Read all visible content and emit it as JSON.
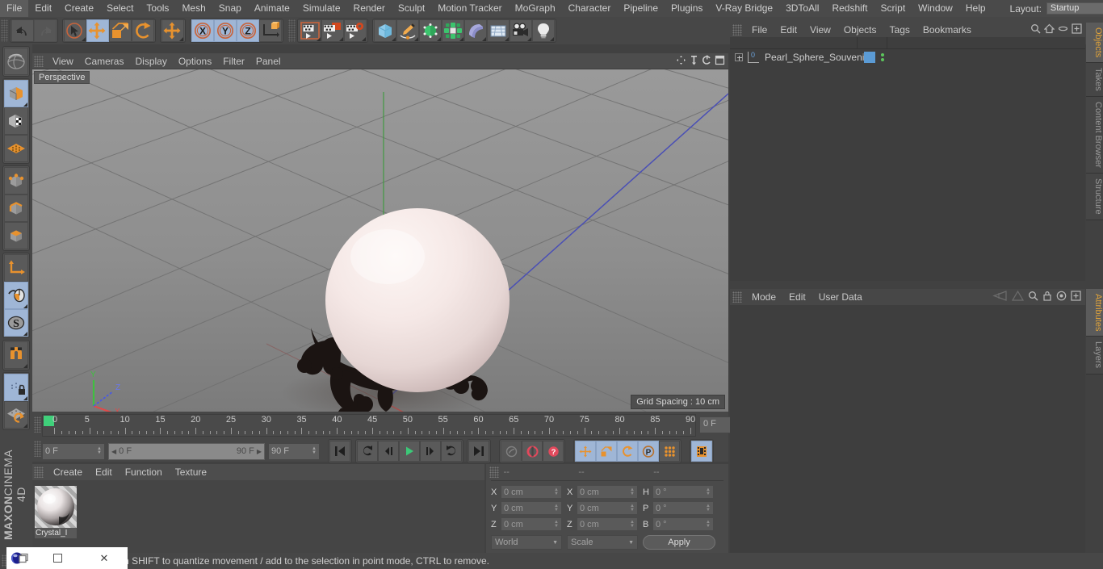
{
  "menubar": {
    "items": [
      "File",
      "Edit",
      "Create",
      "Select",
      "Tools",
      "Mesh",
      "Snap",
      "Animate",
      "Simulate",
      "Render",
      "Sculpt",
      "Motion Tracker",
      "MoGraph",
      "Character",
      "Pipeline",
      "Plugins",
      "V-Ray Bridge",
      "3DToAll",
      "Redshift",
      "Script",
      "Window",
      "Help"
    ],
    "layout_label": "Layout:",
    "layout_value": "Startup",
    "icons": [
      "search-icon",
      "home-icon",
      "minimize-icon",
      "maximize-icon"
    ]
  },
  "toolbar": {
    "groups": [
      {
        "name": "undo-redo",
        "buttons": [
          {
            "icon": "undo-icon",
            "label": "Undo",
            "selected": false,
            "dim": false,
            "corner": false
          },
          {
            "icon": "redo-icon",
            "label": "Redo",
            "selected": false,
            "dim": true,
            "corner": false
          }
        ]
      },
      {
        "name": "selection-transform",
        "buttons": [
          {
            "icon": "live-selection-icon",
            "label": "Live Selection",
            "selected": false,
            "dim": false,
            "corner": true
          },
          {
            "icon": "move-icon",
            "label": "Move",
            "selected": true,
            "dim": false,
            "corner": false
          },
          {
            "icon": "scale-icon",
            "label": "Scale",
            "selected": false,
            "dim": false,
            "corner": false
          },
          {
            "icon": "rotate-icon",
            "label": "Rotate",
            "selected": false,
            "dim": false,
            "corner": false
          }
        ]
      },
      {
        "name": "move-dup",
        "buttons": [
          {
            "icon": "move-icon",
            "label": "Move",
            "selected": false,
            "dim": false,
            "corner": true
          }
        ]
      },
      {
        "name": "axis-locks",
        "buttons": [
          {
            "icon": "x-axis-icon",
            "label": "X Axis",
            "selected": true,
            "dim": false,
            "corner": false
          },
          {
            "icon": "y-axis-icon",
            "label": "Y Axis",
            "selected": true,
            "dim": false,
            "corner": false
          },
          {
            "icon": "z-axis-icon",
            "label": "Z Axis",
            "selected": true,
            "dim": false,
            "corner": false
          },
          {
            "icon": "world-coordinates-icon",
            "label": "World/Object Coordinates",
            "selected": false,
            "dim": false,
            "corner": false
          }
        ]
      },
      {
        "name": "render",
        "buttons": [
          {
            "icon": "render-view-icon",
            "label": "Render View",
            "selected": false,
            "dim": false,
            "corner": true
          },
          {
            "icon": "render-to-picture-viewer-icon",
            "label": "Render to Picture Viewer",
            "selected": false,
            "dim": false,
            "corner": true
          },
          {
            "icon": "render-settings-icon",
            "label": "Edit Render Settings",
            "selected": false,
            "dim": false,
            "corner": true
          }
        ]
      },
      {
        "name": "create-objects",
        "buttons": [
          {
            "icon": "cube-primitive-icon",
            "label": "Add Cube Object",
            "selected": false,
            "dim": false,
            "corner": true
          },
          {
            "icon": "spline-pen-icon",
            "label": "Add Spline Object",
            "selected": false,
            "dim": false,
            "corner": true
          },
          {
            "icon": "generator-icon",
            "label": "Add Generator Object",
            "selected": false,
            "dim": false,
            "corner": true
          },
          {
            "icon": "cloner-icon",
            "label": "Add MoGraph Object",
            "selected": false,
            "dim": false,
            "corner": true
          },
          {
            "icon": "deformer-icon",
            "label": "Add Deformer Object",
            "selected": false,
            "dim": false,
            "corner": true
          },
          {
            "icon": "environment-icon",
            "label": "Add Environment Object",
            "selected": false,
            "dim": false,
            "corner": true
          },
          {
            "icon": "camera-icon",
            "label": "Add Camera Object",
            "selected": false,
            "dim": false,
            "corner": true
          },
          {
            "icon": "light-icon",
            "label": "Add Light Object",
            "selected": false,
            "dim": false,
            "corner": true
          }
        ]
      }
    ]
  },
  "left_toolbar": {
    "groups": [
      {
        "buttons": [
          {
            "icon": "undo-view-icon",
            "label": "Undo View",
            "selected": false,
            "corner": false
          }
        ]
      },
      {
        "buttons": [
          {
            "icon": "model-mode-icon",
            "label": "Model Mode",
            "selected": true,
            "corner": true
          },
          {
            "icon": "texture-mode-icon",
            "label": "Texture Mode",
            "selected": false,
            "corner": false
          },
          {
            "icon": "workplane-mode-icon",
            "label": "Workplane Mode",
            "selected": false,
            "corner": false
          }
        ]
      },
      {
        "buttons": [
          {
            "icon": "points-mode-icon",
            "label": "Points Mode",
            "selected": false,
            "corner": false
          },
          {
            "icon": "edges-mode-icon",
            "label": "Edges Mode",
            "selected": false,
            "corner": false
          },
          {
            "icon": "polygons-mode-icon",
            "label": "Polygons Mode",
            "selected": false,
            "corner": false
          }
        ]
      },
      {
        "buttons": [
          {
            "icon": "axis-modify-icon",
            "label": "Enable Axis Modification",
            "selected": false,
            "corner": false
          },
          {
            "icon": "viewport-solo-icon",
            "label": "Enable Viewport Solo",
            "selected": true,
            "corner": true
          },
          {
            "icon": "soft-selection-icon",
            "label": "Soft Selection",
            "selected": true,
            "corner": true
          }
        ]
      },
      {
        "buttons": [
          {
            "icon": "magnet-icon",
            "label": "Magnet",
            "selected": false,
            "corner": true
          }
        ]
      },
      {
        "buttons": [
          {
            "icon": "lock-workplane-icon",
            "label": "Lock Workplane",
            "selected": true,
            "corner": true
          },
          {
            "icon": "planar-workplane-icon",
            "label": "Planar Workplane",
            "selected": false,
            "corner": true
          }
        ]
      }
    ],
    "brand_line1": "MAXON",
    "brand_line2": "CINEMA 4D"
  },
  "viewport": {
    "menu": [
      "View",
      "Cameras",
      "Display",
      "Options",
      "Filter",
      "Panel"
    ],
    "header_icons": [
      "move-view-icon",
      "scale-view-icon",
      "rotate-view-icon",
      "maximize-view-icon"
    ],
    "label": "Perspective",
    "grid_spacing": "Grid Spacing : 10 cm",
    "axis_labels": {
      "x": "X",
      "y": "Y",
      "z": "Z"
    },
    "scene": {
      "object_name": "Pearl_Sphere_Souvenir",
      "sphere_color": "#f3e6e4",
      "stand_color": "#1a1210",
      "floor_color": "#8c8c8c",
      "grid_line_color": "#6e6e6e"
    }
  },
  "timeline": {
    "ruler_labels": [
      "0",
      "5",
      "10",
      "15",
      "20",
      "25",
      "30",
      "35",
      "40",
      "45",
      "50",
      "55",
      "60",
      "65",
      "70",
      "75",
      "80",
      "85",
      "90"
    ],
    "current_frame_box": "0 F",
    "start_field": "0 F",
    "range_left": "0 F",
    "range_right": "90 F",
    "end_field": "90 F",
    "playback_buttons": [
      {
        "icon": "go-to-start-icon",
        "label": "Go To Start",
        "selected": false
      },
      {
        "icon": "previous-keyframe-icon",
        "label": "Go To Previous Key",
        "selected": false
      },
      {
        "icon": "step-back-icon",
        "label": "Go To Previous Frame",
        "selected": false
      },
      {
        "icon": "play-forward-icon",
        "label": "Play Forwards",
        "selected": false
      },
      {
        "icon": "step-forward-icon",
        "label": "Go To Next Frame",
        "selected": false
      },
      {
        "icon": "next-keyframe-icon",
        "label": "Go To Next Key",
        "selected": false
      },
      {
        "icon": "go-to-end-icon",
        "label": "Go To End",
        "selected": false
      }
    ],
    "record_buttons": [
      {
        "icon": "autokeying-icon",
        "label": "Autokeying",
        "selected": false,
        "dim": true
      },
      {
        "icon": "record-active-objects-icon",
        "label": "Record Active Objects",
        "selected": false
      },
      {
        "icon": "keyframe-selection-icon",
        "label": "Keyframe Selection",
        "selected": false
      }
    ],
    "param_buttons": [
      {
        "icon": "position-key-icon",
        "label": "Position",
        "selected": true
      },
      {
        "icon": "scale-key-icon",
        "label": "Scale",
        "selected": true
      },
      {
        "icon": "rotation-key-icon",
        "label": "Rotation",
        "selected": true
      },
      {
        "icon": "pla-key-icon",
        "label": "Point Level Animation",
        "selected": true
      },
      {
        "icon": "parameter-key-icon",
        "label": "Parameter",
        "selected": false
      }
    ],
    "dope_sheet_button": {
      "icon": "dope-sheet-icon",
      "label": "Timeline",
      "selected": true
    }
  },
  "material_manager": {
    "menu": [
      "Create",
      "Edit",
      "Function",
      "Texture"
    ],
    "materials": [
      {
        "name": "Crystal_I",
        "selected": true
      }
    ]
  },
  "coordinates": {
    "column_headers": [
      "--",
      "--",
      "--"
    ],
    "rows": [
      {
        "pos_label": "X",
        "pos_value": "0 cm",
        "size_label": "X",
        "size_value": "0 cm",
        "rot_label": "H",
        "rot_value": "0 °"
      },
      {
        "pos_label": "Y",
        "pos_value": "0 cm",
        "size_label": "Y",
        "size_value": "0 cm",
        "rot_label": "P",
        "rot_value": "0 °"
      },
      {
        "pos_label": "Z",
        "pos_value": "0 cm",
        "size_label": "Z",
        "size_value": "0 cm",
        "rot_label": "B",
        "rot_value": "0 °"
      }
    ],
    "system_value": "World",
    "mode_value": "Scale",
    "apply_label": "Apply"
  },
  "object_manager": {
    "menu": [
      "File",
      "Edit",
      "View",
      "Objects",
      "Tags",
      "Bookmarks"
    ],
    "icons": [
      "search-icon",
      "home-icon",
      "ellipse-icon",
      "plus-box-icon"
    ],
    "objects": [
      {
        "name": "Pearl_Sphere_Souvenir",
        "layer_number": "0",
        "swatch_color": "#5b9bd5",
        "selected": false
      }
    ]
  },
  "attribute_manager": {
    "menu": [
      "Mode",
      "Edit",
      "User Data"
    ],
    "icons": [
      "mode-left-icon",
      "mode-right-icon",
      "search-icon",
      "lock-icon",
      "target-icon",
      "plus-box-icon"
    ],
    "content": ""
  },
  "right_tabs": {
    "top": [
      {
        "label": "Objects",
        "active": true
      },
      {
        "label": "Takes",
        "active": false
      },
      {
        "label": "Content Browser",
        "active": false
      },
      {
        "label": "Structure",
        "active": false
      }
    ],
    "bottom": [
      {
        "label": "Attributes",
        "active": true
      },
      {
        "label": "Layers",
        "active": false
      }
    ]
  },
  "statusbar": {
    "text": "Move elements. Hold down SHIFT to quantize movement / add to the selection in point mode, CTRL to remove."
  },
  "window_controls": {
    "app_icon": "cinema4d-app-icon",
    "restore_label": "❐",
    "maximize_label": "",
    "close_label": "✕"
  }
}
